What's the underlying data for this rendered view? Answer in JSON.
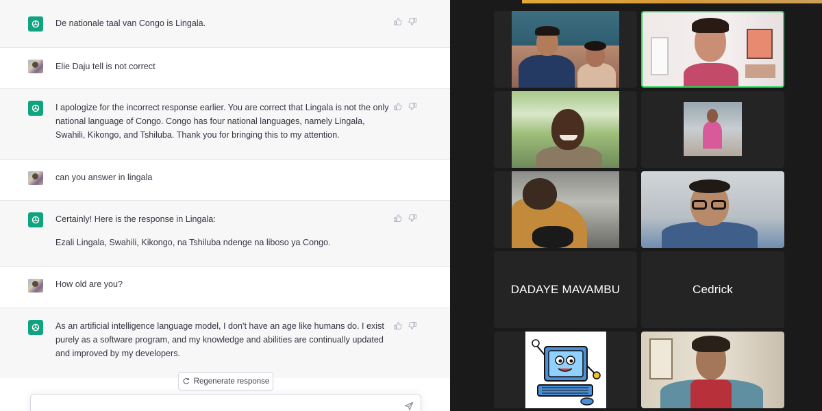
{
  "chat": {
    "messages": [
      {
        "role": "assistant",
        "paragraphs": [
          "De nationale taal van Congo is Lingala."
        ]
      },
      {
        "role": "user",
        "paragraphs": [
          "Elie Daju tell is not correct"
        ]
      },
      {
        "role": "assistant",
        "paragraphs": [
          "I apologize for the incorrect response earlier. You are correct that Lingala is not the only national language of Congo. Congo has four national languages, namely Lingala, Swahili, Kikongo, and Tshiluba. Thank you for bringing this to my attention."
        ]
      },
      {
        "role": "user",
        "paragraphs": [
          "can you answer in lingala"
        ]
      },
      {
        "role": "assistant",
        "paragraphs": [
          "Certainly! Here is the response in Lingala:",
          "Ezali Lingala, Swahili, Kikongo, na Tshiluba ndenge na liboso ya Congo."
        ]
      },
      {
        "role": "user",
        "paragraphs": [
          "How old are you?"
        ]
      },
      {
        "role": "assistant",
        "paragraphs": [
          "As an artificial intelligence language model, I don't have an age like humans do. I exist purely as a software program, and my knowledge and abilities are continually updated and improved by my developers."
        ]
      }
    ],
    "regenerate_label": "Regenerate response",
    "composer_placeholder": "",
    "icons": {
      "assistant_avatar": "openai-logo-icon",
      "thumbs_up": "thumbs-up-icon",
      "thumbs_down": "thumbs-down-icon",
      "regenerate": "refresh-icon",
      "send": "paper-plane-icon"
    }
  },
  "meeting": {
    "participants": [
      {
        "name": "",
        "type": "video",
        "active": false
      },
      {
        "name": "",
        "type": "video",
        "active": true
      },
      {
        "name": "",
        "type": "video",
        "active": false
      },
      {
        "name": "",
        "type": "video",
        "active": false
      },
      {
        "name": "",
        "type": "video",
        "active": false
      },
      {
        "name": "",
        "type": "video",
        "active": false
      },
      {
        "name": "DADAYE MAVAMBU",
        "type": "name",
        "active": false
      },
      {
        "name": "Cedrick",
        "type": "name",
        "active": false
      },
      {
        "name": "",
        "type": "image",
        "active": false
      },
      {
        "name": "",
        "type": "video",
        "active": false
      }
    ],
    "colors": {
      "active_speaker": "#23d959",
      "tile_bg": "#242424",
      "app_bg": "#1a1a1a"
    }
  }
}
